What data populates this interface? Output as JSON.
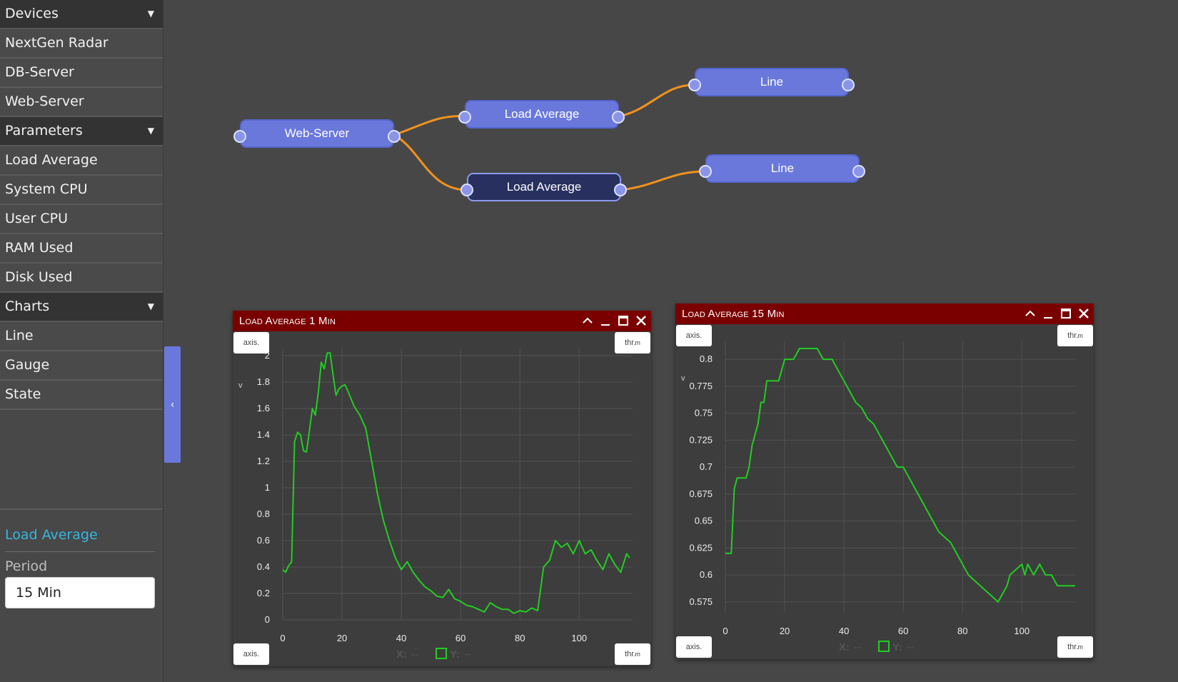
{
  "sidebar": {
    "sections": [
      {
        "label": "Devices",
        "items": [
          "NextGen Radar",
          "DB-Server",
          "Web-Server"
        ]
      },
      {
        "label": "Parameters",
        "items": [
          "Load Average",
          "System CPU",
          "User CPU",
          "RAM Used",
          "Disk Used"
        ]
      },
      {
        "label": "Charts",
        "items": [
          "Line",
          "Gauge",
          "State"
        ]
      }
    ],
    "caret_icon": "caret-down-icon",
    "collapse_icon": "chevron-left-icon",
    "collapse_glyph": "‹"
  },
  "properties": {
    "title": "Load Average",
    "period_label": "Period",
    "period_value": "15 Min"
  },
  "graph": {
    "nodes": {
      "web_server": "Web-Server",
      "load_avg_top": "Load Average",
      "load_avg_bottom": "Load Average",
      "line_top": "Line",
      "line_bottom": "Line"
    },
    "selected": "load_avg_bottom",
    "link_color": "#f0921e"
  },
  "windows": [
    {
      "title": "Load Average 1 Min",
      "chip_axis": "axis.",
      "chip_thr": "thr.",
      "chip_thr_suffix": "m",
      "readout_x_label": "X:",
      "readout_x_value": "--",
      "readout_y_label": "Y:",
      "readout_y_value": "--",
      "y_axis_label": "v"
    },
    {
      "title": "Load Average 15 Min",
      "chip_axis": "axis.",
      "chip_thr": "thr.",
      "chip_thr_suffix": "m",
      "readout_x_label": "X:",
      "readout_x_value": "--",
      "readout_y_label": "Y:",
      "readout_y_value": "--",
      "y_axis_label": "v"
    }
  ],
  "colors": {
    "titlebar": "#7a0000",
    "node": "#6a78dc",
    "node_selected": "#27305f",
    "line": "#22cc22",
    "accent_text": "#38b6e0"
  },
  "chart_data": [
    {
      "type": "line",
      "title": "Load Average 1 Min",
      "xlabel": "",
      "ylabel": "v",
      "xlim": [
        0,
        118
      ],
      "ylim": [
        0,
        2
      ],
      "x_ticks": [
        0,
        20,
        40,
        60,
        80,
        100
      ],
      "y_ticks": [
        0,
        0.2,
        0.4,
        0.6,
        0.8,
        1,
        1.2,
        1.4,
        1.6,
        1.8,
        2
      ],
      "grid": true,
      "series": [
        {
          "color": "#22cc22",
          "x": [
            0,
            1,
            2,
            3,
            4,
            5,
            6,
            7,
            8,
            9,
            10,
            11,
            12,
            13,
            14,
            15,
            16,
            17,
            18,
            19,
            20,
            21,
            22,
            24,
            26,
            28,
            30,
            32,
            34,
            36,
            38,
            40,
            42,
            44,
            46,
            48,
            50,
            52,
            54,
            56,
            58,
            60,
            62,
            64,
            66,
            68,
            70,
            72,
            74,
            76,
            78,
            80,
            82,
            84,
            86,
            88,
            90,
            92,
            94,
            96,
            98,
            100,
            102,
            104,
            106,
            108,
            110,
            112,
            114,
            116,
            117
          ],
          "y": [
            0.38,
            0.36,
            0.41,
            0.44,
            1.35,
            1.42,
            1.4,
            1.28,
            1.27,
            1.43,
            1.6,
            1.55,
            1.72,
            1.95,
            1.9,
            2.02,
            2.02,
            1.85,
            1.7,
            1.75,
            1.77,
            1.78,
            1.73,
            1.62,
            1.55,
            1.45,
            1.2,
            0.95,
            0.75,
            0.6,
            0.47,
            0.38,
            0.44,
            0.36,
            0.3,
            0.25,
            0.22,
            0.18,
            0.17,
            0.23,
            0.16,
            0.14,
            0.11,
            0.1,
            0.08,
            0.06,
            0.13,
            0.1,
            0.08,
            0.08,
            0.05,
            0.07,
            0.06,
            0.09,
            0.07,
            0.4,
            0.45,
            0.6,
            0.55,
            0.58,
            0.5,
            0.6,
            0.5,
            0.53,
            0.45,
            0.38,
            0.5,
            0.42,
            0.36,
            0.5,
            0.47
          ]
        }
      ]
    },
    {
      "type": "line",
      "title": "Load Average 15 Min",
      "xlabel": "",
      "ylabel": "v",
      "xlim": [
        0,
        118
      ],
      "ylim": [
        0.565,
        0.81
      ],
      "x_ticks": [
        0,
        20,
        40,
        60,
        80,
        100
      ],
      "y_ticks": [
        0.575,
        0.6,
        0.625,
        0.65,
        0.675,
        0.7,
        0.725,
        0.75,
        0.775,
        0.8
      ],
      "grid": true,
      "series": [
        {
          "color": "#22cc22",
          "x": [
            0,
            2,
            3,
            4,
            5,
            6,
            7,
            8,
            9,
            10,
            11,
            12,
            13,
            14,
            15,
            16,
            17,
            18,
            19,
            20,
            21,
            22,
            23,
            24,
            25,
            26,
            27,
            28,
            29,
            30,
            31,
            32,
            33,
            34,
            35,
            36,
            37,
            38,
            40,
            42,
            44,
            46,
            48,
            50,
            52,
            54,
            56,
            58,
            60,
            62,
            64,
            66,
            68,
            70,
            72,
            74,
            76,
            78,
            80,
            82,
            84,
            86,
            88,
            90,
            92,
            94,
            95,
            96,
            98,
            100,
            101,
            102,
            104,
            106,
            108,
            110,
            112,
            114,
            116,
            118
          ],
          "y": [
            0.62,
            0.62,
            0.68,
            0.69,
            0.69,
            0.69,
            0.69,
            0.7,
            0.72,
            0.73,
            0.74,
            0.76,
            0.76,
            0.78,
            0.78,
            0.78,
            0.78,
            0.78,
            0.79,
            0.8,
            0.8,
            0.8,
            0.8,
            0.805,
            0.81,
            0.81,
            0.81,
            0.81,
            0.81,
            0.81,
            0.81,
            0.805,
            0.8,
            0.8,
            0.8,
            0.8,
            0.795,
            0.79,
            0.78,
            0.77,
            0.76,
            0.755,
            0.745,
            0.74,
            0.73,
            0.72,
            0.71,
            0.7,
            0.7,
            0.69,
            0.68,
            0.67,
            0.66,
            0.65,
            0.64,
            0.635,
            0.63,
            0.62,
            0.61,
            0.6,
            0.595,
            0.59,
            0.585,
            0.58,
            0.575,
            0.585,
            0.59,
            0.6,
            0.605,
            0.61,
            0.6,
            0.61,
            0.6,
            0.61,
            0.6,
            0.6,
            0.59,
            0.59,
            0.59,
            0.59
          ]
        }
      ]
    }
  ]
}
